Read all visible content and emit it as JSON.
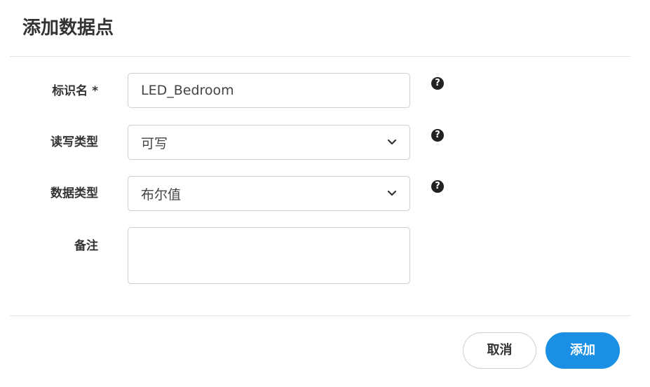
{
  "dialog": {
    "title": "添加数据点",
    "fields": [
      {
        "label": "标识名 *",
        "value": "LED_Bedroom",
        "type": "text"
      },
      {
        "label": "读写类型",
        "value": "可写",
        "type": "select"
      },
      {
        "label": "数据类型",
        "value": "布尔值",
        "type": "select"
      },
      {
        "label": "备注",
        "value": "",
        "type": "textarea"
      }
    ],
    "help_glyph": "?",
    "buttons": {
      "cancel": "取消",
      "submit": "添加"
    }
  },
  "colors": {
    "primary": "#1a8fe3",
    "border": "#cfcfcf",
    "divider": "#e5e5e5",
    "text": "#333333"
  },
  "icons": {
    "help": "question-circle-icon",
    "dropdown": "chevron-down-icon"
  }
}
